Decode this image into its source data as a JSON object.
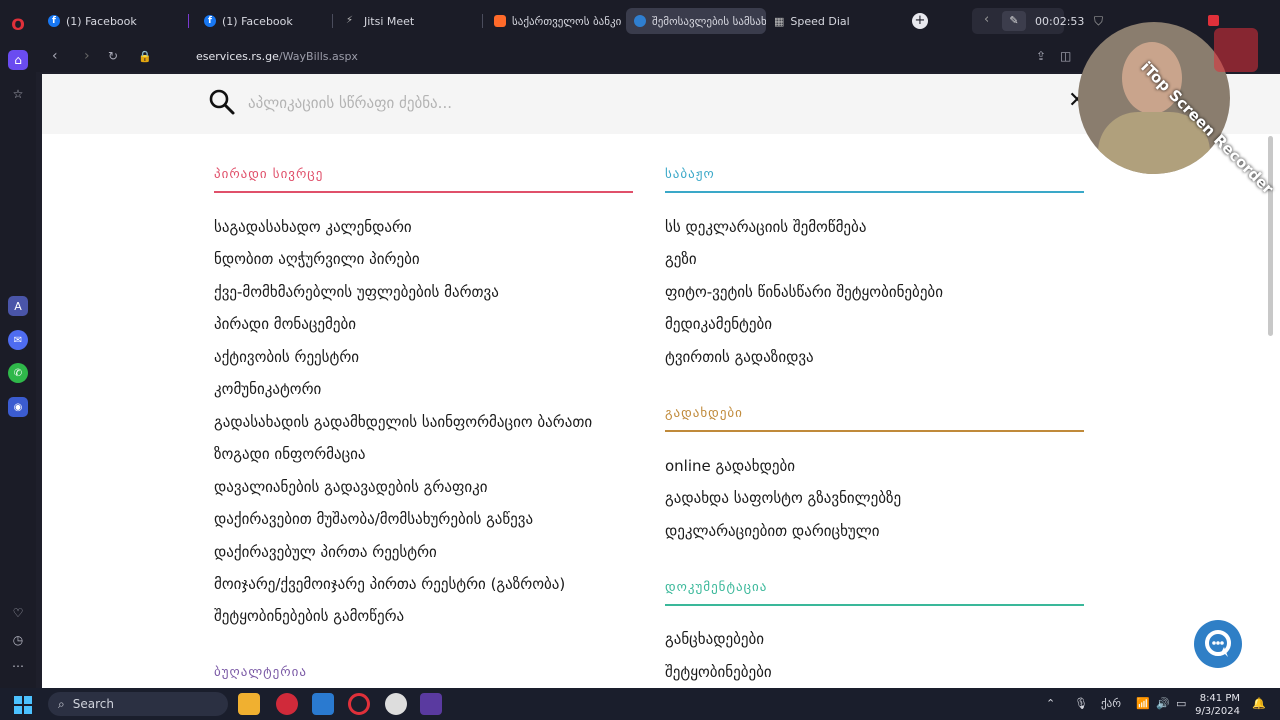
{
  "browser": {
    "tabs": [
      {
        "label": "(1) Facebook",
        "icon": "facebook-icon",
        "active": false
      },
      {
        "label": "(1) Facebook",
        "icon": "facebook-icon",
        "active": false
      },
      {
        "label": "Jitsi Meet",
        "icon": "jitsi-icon",
        "active": false
      },
      {
        "label": "საქართველოს ბანკი -",
        "icon": "bank-icon",
        "active": false
      },
      {
        "label": "შემოსავლების სამსახ",
        "icon": "rs-icon",
        "active": true
      },
      {
        "label": "Speed Dial",
        "icon": "speed-dial-icon",
        "active": false
      }
    ],
    "new_tab": "+",
    "timer": "00:02:53",
    "url_host": "eservices.rs.ge",
    "url_path": "/WayBills.aspx"
  },
  "search": {
    "placeholder": "აპლიკაციის სწრაფი ძებნა...",
    "close": "✕"
  },
  "left_column": {
    "section1": {
      "title": "პირადი სივრცე",
      "color": "#e0506a",
      "items": [
        "საგადასახადო კალენდარი",
        "ნდობით აღჭურვილი პირები",
        "ქვე-მომხმარებლის უფლებების მართვა",
        "პირადი მონაცემები",
        "აქტივობის რეესტრი",
        "კომუნიკატორი",
        "გადასახადის გადამხდელის საინფორმაციო ბარათი",
        "ზოგადი ინფორმაცია",
        "დავალიანების გადავადების გრაფიკი",
        "დაქირავებით მუშაობა/მომსახურების გაწევა",
        "დაქირავებულ პირთა რეესტრი",
        "მოიჯარე/ქვემოიჯარე პირთა რეესტრი (გაზრობა)",
        "შეტყობინებების გამოწერა"
      ]
    },
    "section2": {
      "title": "ბუღალტერია",
      "color": "#7b5aa6"
    }
  },
  "right_column": {
    "section1": {
      "title": "საბაჟო",
      "color": "#3aa8c8",
      "items": [
        "სს დეკლარაციის შემოწმება",
        "გეზი",
        "ფიტო-ვეტის წინასწარი შეტყობინებები",
        "მედიკამენტები",
        "ტვირთის გადაზიდვა"
      ]
    },
    "section2": {
      "title": "გადახდები",
      "color": "#c08a3a",
      "items": [
        "online გადახდები",
        "გადახდა საფოსტო გზავნილებზე",
        "დეკლარაციებით დარიცხული"
      ]
    },
    "section3": {
      "title": "დოკუმენტაცია",
      "color": "#3ab89a",
      "items": [
        "განცხადებები",
        "შეტყობინებები"
      ]
    }
  },
  "watermark": "iTop Screen Recorder",
  "taskbar": {
    "search_label": "Search",
    "lang": "ქარ",
    "time": "8:41 PM",
    "date": "9/3/2024"
  }
}
